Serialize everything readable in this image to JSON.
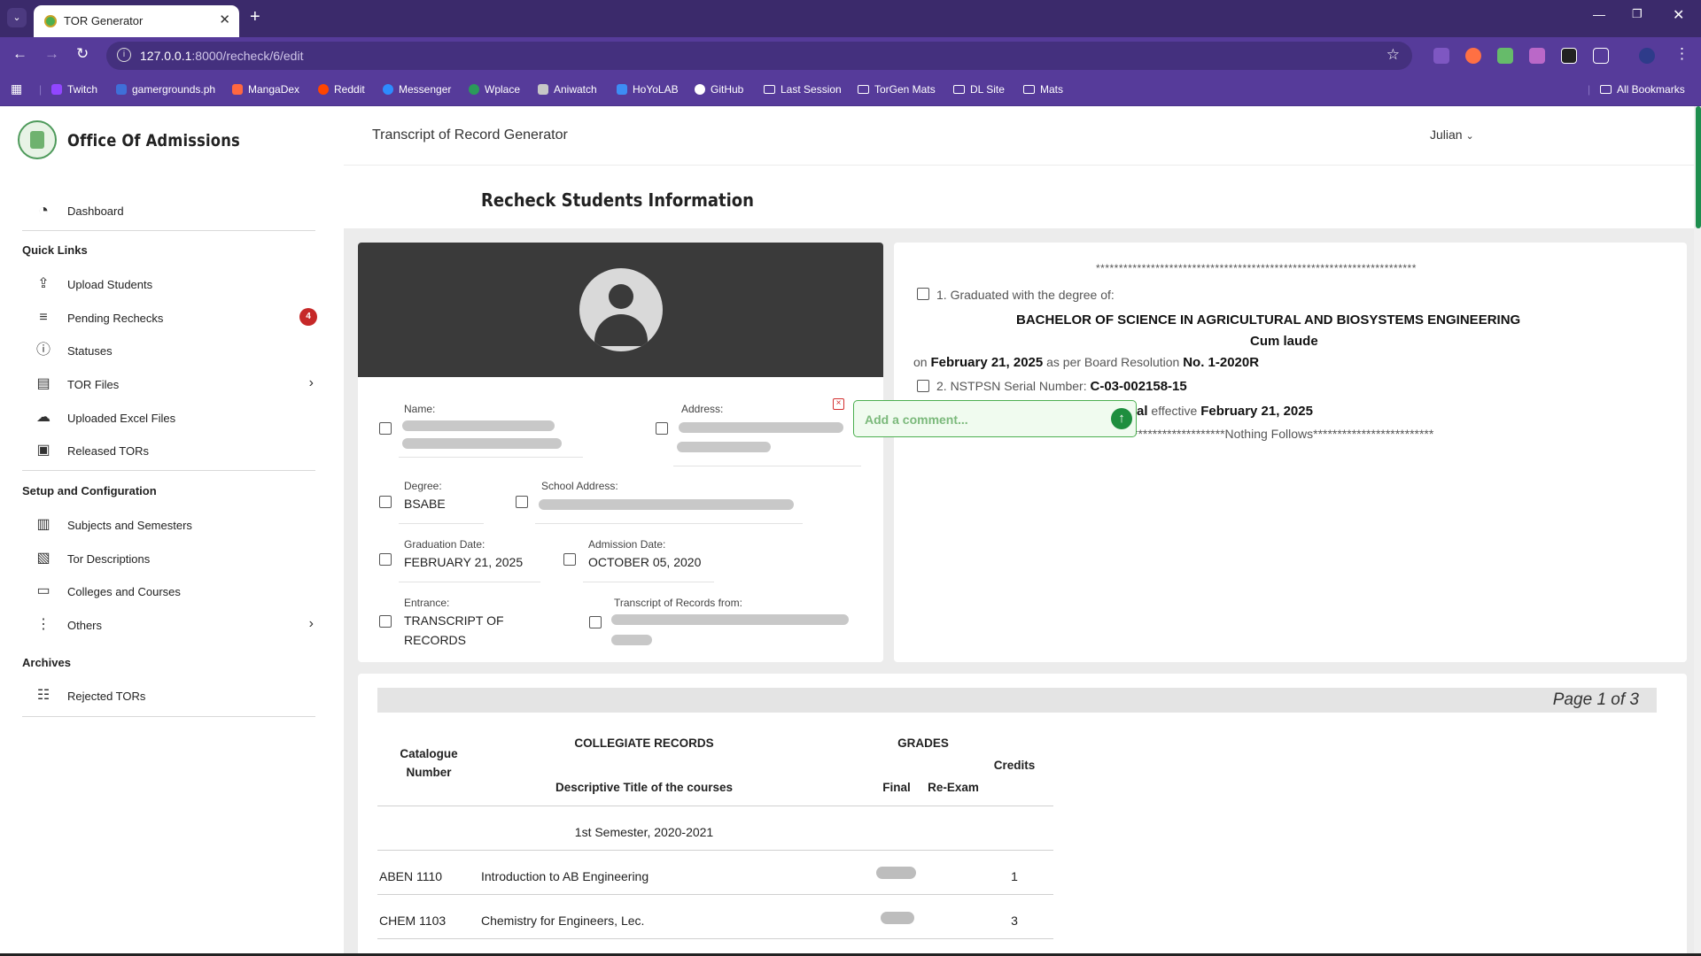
{
  "browser": {
    "tab_title": "TOR Generator",
    "url_host": "127.0.0.1",
    "url_path": ":8000/recheck/6/edit",
    "bookmarks": [
      {
        "label": "Twitch",
        "color": "#9146ff"
      },
      {
        "label": "gamergrounds.ph",
        "color": "#3f6fd8"
      },
      {
        "label": "MangaDex",
        "color": "#ff6740"
      },
      {
        "label": "Reddit",
        "color": "#ff4500"
      },
      {
        "label": "Messenger",
        "color": "#2d8cff"
      },
      {
        "label": "Wplace",
        "color": "#2b9a5a"
      },
      {
        "label": "Aniwatch",
        "color": "#c7c7c7"
      },
      {
        "label": "HoYoLAB",
        "color": "#3d8df5"
      },
      {
        "label": "GitHub",
        "color": "#ffffff"
      },
      {
        "label": "Last Session",
        "folder": true
      },
      {
        "label": "TorGen Mats",
        "folder": true
      },
      {
        "label": "DL Site",
        "folder": true
      },
      {
        "label": "Mats",
        "folder": true
      }
    ],
    "all_bookmarks": "All Bookmarks"
  },
  "sidebar": {
    "brand": "Office Of Admissions",
    "dashboard": "Dashboard",
    "quick_links_heading": "Quick Links",
    "quick_links": [
      {
        "label": "Upload Students",
        "icon": "upload-icon"
      },
      {
        "label": "Pending Rechecks",
        "icon": "list-edit-icon",
        "badge": "4"
      },
      {
        "label": "Statuses",
        "icon": "info-icon"
      },
      {
        "label": "TOR Files",
        "icon": "calendar-icon",
        "has_children": true
      },
      {
        "label": "Uploaded Excel Files",
        "icon": "cloud-upload-icon"
      },
      {
        "label": "Released TORs",
        "icon": "archive-icon"
      }
    ],
    "setup_heading": "Setup and Configuration",
    "setup_links": [
      {
        "label": "Subjects and Semesters",
        "icon": "book-list-icon"
      },
      {
        "label": "Tor Descriptions",
        "icon": "document-person-icon"
      },
      {
        "label": "Colleges and Courses",
        "icon": "id-card-icon"
      },
      {
        "label": "Others",
        "icon": "more-vertical-icon",
        "has_children": true
      }
    ],
    "archives_heading": "Archives",
    "archive_links": [
      {
        "label": "Rejected TORs",
        "icon": "list-box-icon"
      }
    ]
  },
  "topbar": {
    "title": "Transcript of Record Generator",
    "user": "Julian"
  },
  "page": {
    "title": "Recheck Students Information"
  },
  "student": {
    "name_label": "Name:",
    "address_label": "Address:",
    "degree_label": "Degree:",
    "degree_value": "BSABE",
    "school_address_label": "School Address:",
    "graduation_label": "Graduation Date:",
    "graduation_value": "FEBRUARY 21, 2025",
    "admission_label": "Admission Date:",
    "admission_value": "OCTOBER 05, 2020",
    "entrance_label": "Entrance:",
    "entrance_value_line1": "TRANSCRIPT OF",
    "entrance_value_line2": "RECORDS",
    "tor_from_label": "Transcript of Records from:",
    "comment_placeholder": "Add a comment..."
  },
  "degree_panel": {
    "stars_top": "**********************************************************************",
    "item1_label": "1. Graduated with the degree of:",
    "degree_name": "BACHELOR OF SCIENCE IN AGRICULTURAL AND BIOSYSTEMS ENGINEERING",
    "honor": "Cum laude",
    "on_word": "on",
    "on_date": "February 21, 2025",
    "resolution_text": "as per Board Resolution",
    "resolution_no": "No. 1-2020R",
    "item2_label": "2. NSTPSN Serial Number:",
    "serial": "C-03-002158-15",
    "hidden_tail": "al",
    "effective_word": "effective",
    "effective_date": "February 21, 2025",
    "nothing_follows": "*******************Nothing Follows*************************"
  },
  "records": {
    "page_indicator": "Page 1 of 3",
    "col_catalogue_1": "Catalogue",
    "col_catalogue_2": "Number",
    "col_collegiate": "COLLEGIATE RECORDS",
    "col_descriptive": "Descriptive Title of the courses",
    "col_grades": "GRADES",
    "col_final": "Final",
    "col_reexam": "Re-Exam",
    "col_credits": "Credits",
    "semester": "1st Semester, 2020-2021",
    "rows": [
      {
        "code": "ABEN 1110",
        "title": "Introduction to AB Engineering",
        "credits": "1"
      },
      {
        "code": "CHEM 1103",
        "title": "Chemistry for Engineers, Lec.",
        "credits": "3"
      }
    ]
  }
}
